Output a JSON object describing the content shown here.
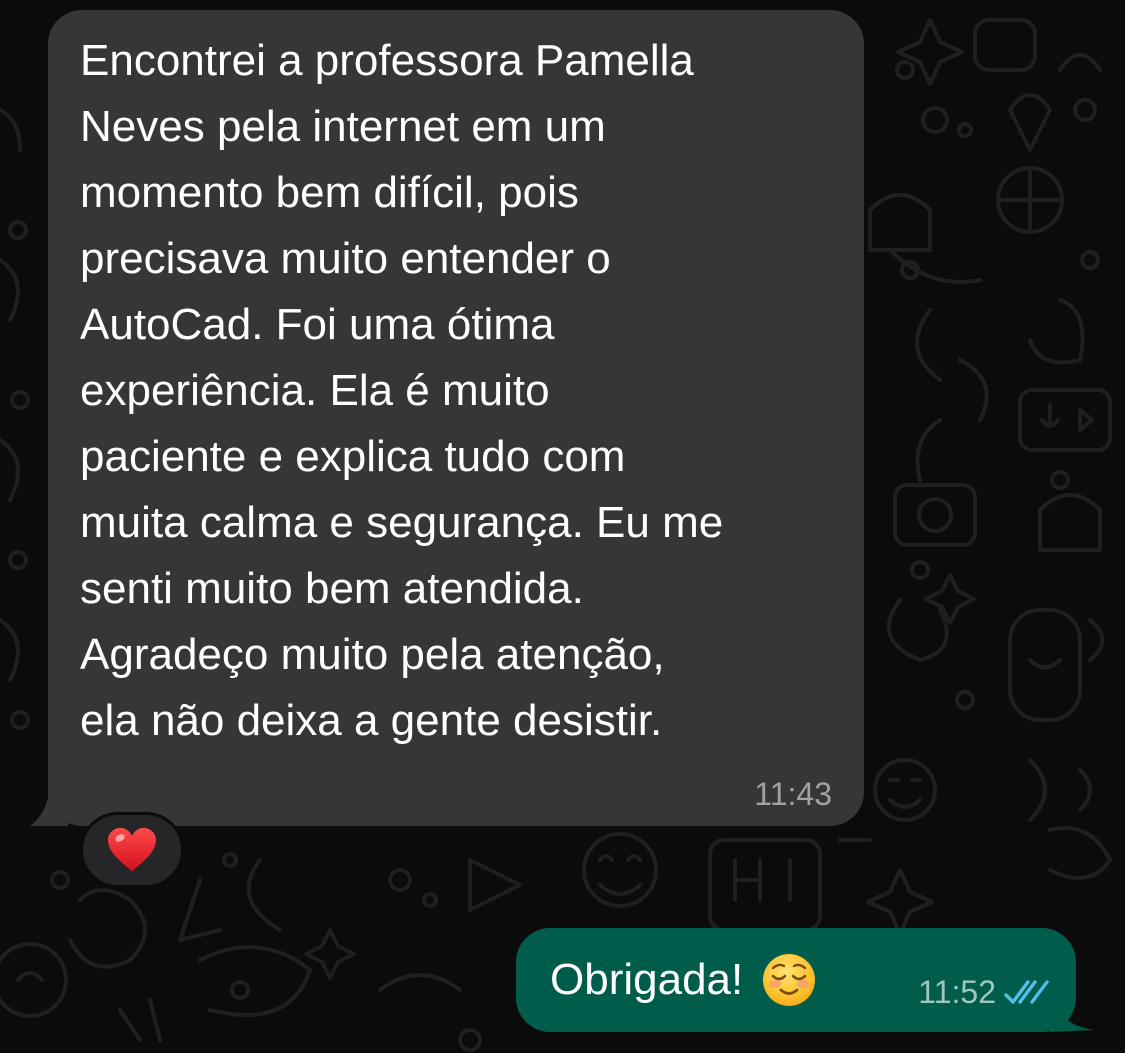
{
  "chat": {
    "incoming": {
      "text": "Encontrei a professora Pamella\nNeves pela internet em um\nmomento bem difícil, pois\nprecisava muito entender o\nAutoCad. Foi uma ótima\nexperiência.  Ela é muito\npaciente e explica tudo com\nmuita calma e segurança. Eu me\nsenti muito bem atendida.\nAgradeço muito pela atenção,\nela não deixa a gente desistir.",
      "time": "11:43",
      "reaction": "heart-icon"
    },
    "outgoing": {
      "text": "Obrigada!",
      "emoji": "smiling-face-icon",
      "time": "11:52",
      "status": "read-double-check-icon"
    }
  },
  "colors": {
    "background": "#0b0b0b",
    "incoming_bubble": "#363638",
    "outgoing_bubble": "#005c4b",
    "read_ticks": "#53bdeb"
  }
}
